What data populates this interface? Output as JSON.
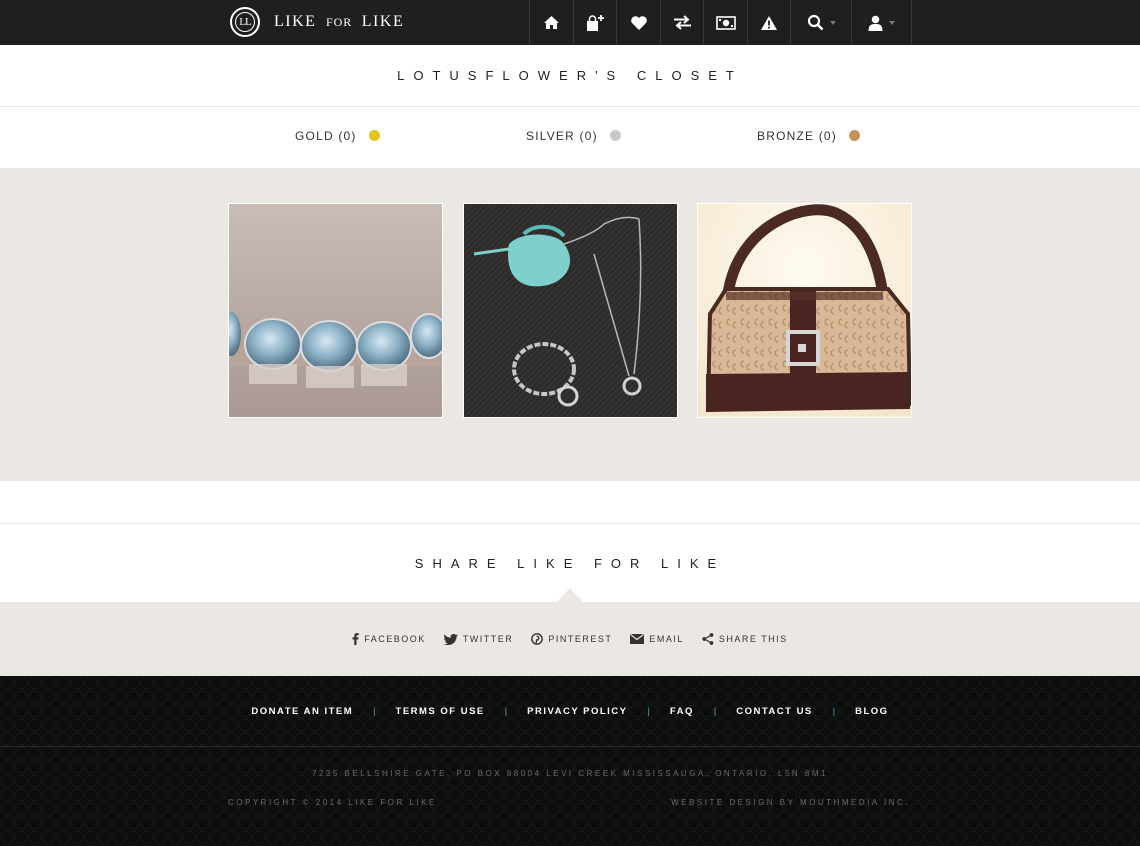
{
  "header": {
    "brand_logo_text": "LL",
    "brand_name_part1": "LIKE",
    "brand_name_part2": "FOR",
    "brand_name_part3": "LIKE",
    "nav_icons": [
      "home-icon",
      "add-bag-icon",
      "heart-icon",
      "exchange-icon",
      "money-icon",
      "warning-icon",
      "search-icon",
      "user-icon"
    ]
  },
  "closet": {
    "title": "LOTUSFLOWER'S CLOSET"
  },
  "tiers": [
    {
      "label": "GOLD (0)",
      "color": "#e3c51b"
    },
    {
      "label": "SILVER (0)",
      "color": "#c9c9c9"
    },
    {
      "label": "BRONZE (0)",
      "color": "#c8915a"
    }
  ],
  "items": [
    "blue-gem-bracelet-image",
    "silver-necklace-bracelet-image",
    "brown-handbag-image"
  ],
  "share": {
    "title": "SHARE LIKE FOR LIKE",
    "links": [
      "FACEBOOK",
      "TWITTER",
      "PINTEREST",
      "EMAIL",
      "SHARE THIS"
    ]
  },
  "footer": {
    "links": [
      "DONATE AN ITEM",
      "TERMS OF USE",
      "PRIVACY POLICY",
      "FAQ",
      "CONTACT US",
      "BLOG"
    ],
    "separator": "|",
    "address": "7235 BELLSHIRE GATE, PO BOX 88004 LEVI CREEK MISSISSAUGA, ONTARIO, L5N 8M1",
    "copyright": "COPYRIGHT © 2014 LIKE FOR LIKE",
    "credit": "WEBSITE DESIGN BY MOUTHMEDIA INC."
  },
  "colors": {
    "topbar": "#1f1f1f",
    "panel": "#ebe8e4",
    "footer_separator": "#49a7d6"
  }
}
